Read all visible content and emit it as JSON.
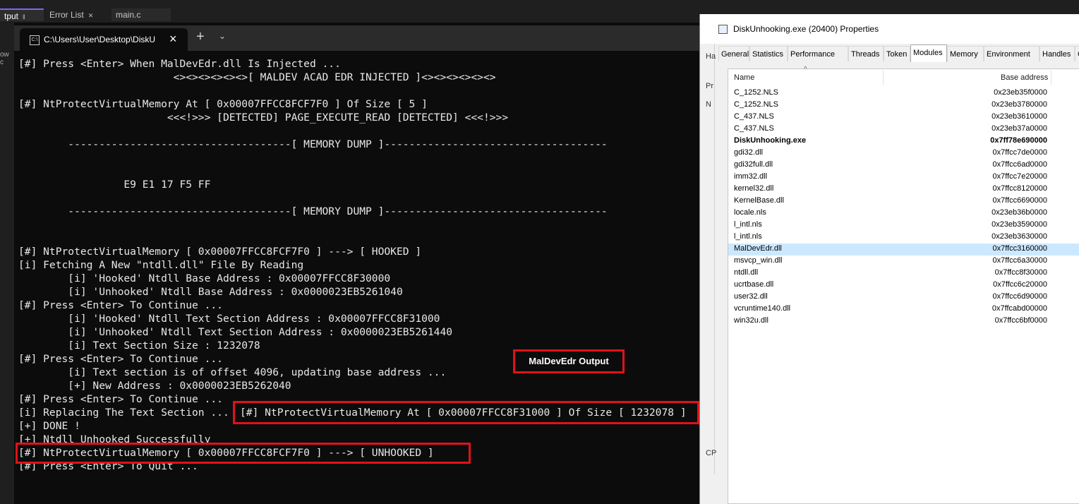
{
  "ide": {
    "tabs": [
      {
        "label": "tput",
        "active": true,
        "pin": "‖",
        "close": ""
      },
      {
        "label": "Error List",
        "active": false,
        "pin": "",
        "close": "✕"
      },
      {
        "label": "main.c",
        "active": false,
        "pin": "",
        "close": ""
      }
    ],
    "left_hint": "ow c"
  },
  "terminal": {
    "tab_title": "C:\\Users\\User\\Desktop\\DiskU",
    "tab_icon": "C:\\",
    "close_glyph": "×",
    "add_glyph": "+",
    "dropdown_glyph": "⌄",
    "lines": [
      "[#] Press <Enter> When MalDevEdr.dll Is Injected ...",
      "                         <><><><><><>[ MALDEV ACAD EDR INJECTED ]<><><><><><>",
      "",
      "[#] NtProtectVirtualMemory At [ 0x00007FFCC8FCF7F0 ] Of Size [ 5 ]",
      "                        <<<!>>> [DETECTED] PAGE_EXECUTE_READ [DETECTED] <<<!>>>",
      "",
      "        ------------------------------------[ MEMORY DUMP ]------------------------------------",
      "",
      "",
      "                 E9 E1 17 F5 FF",
      "",
      "        ------------------------------------[ MEMORY DUMP ]------------------------------------",
      "",
      "",
      "[#] NtProtectVirtualMemory [ 0x00007FFCC8FCF7F0 ] ---> [ HOOKED ]",
      "[i] Fetching A New \"ntdll.dll\" File By Reading",
      "        [i] 'Hooked' Ntdll Base Address : 0x00007FFCC8F30000",
      "        [i] 'Unhooked' Ntdll Base Address : 0x0000023EB5261040",
      "[#] Press <Enter> To Continue ...",
      "        [i] 'Hooked' Ntdll Text Section Address : 0x00007FFCC8F31000",
      "        [i] 'Unhooked' Ntdll Text Section Address : 0x0000023EB5261440",
      "        [i] Text Section Size : 1232078",
      "[#] Press <Enter> To Continue ...",
      "        [i] Text section is of offset 4096, updating base address ...",
      "        [+] New Address : 0x0000023EB5262040",
      "[#] Press <Enter> To Continue ...",
      "[i] Replacing The Text Section ...",
      "[+] DONE !",
      "[+] Ntdll Unhooked Successfully",
      "[#] NtProtectVirtualMemory [ 0x00007FFCC8FCF7F0 ] ---> [ UNHOOKED ]",
      "[#] Press <Enter> To Quit ..."
    ],
    "overlay_line": "[#] NtProtectVirtualMemory At [ 0x00007FFCC8F31000 ] Of Size [ 1232078 ]",
    "callout_label": "MalDevEdr Output"
  },
  "properties": {
    "title": "DiskUnhooking.exe (20400) Properties",
    "behind_hints": [
      "Ha",
      "Pr",
      "N",
      "CP"
    ],
    "tabs": [
      "General",
      "Statistics",
      "Performance",
      "Threads",
      "Token",
      "Modules",
      "Memory",
      "Environment",
      "Handles",
      "GP"
    ],
    "active_tab": "Modules",
    "columns": {
      "name": "Name",
      "base": "Base address"
    },
    "sort_arrow": "^",
    "modules": [
      {
        "name": "C_1252.NLS",
        "base": "0x23eb35f0000",
        "bold": false,
        "selected": false
      },
      {
        "name": "C_1252.NLS",
        "base": "0x23eb3780000",
        "bold": false,
        "selected": false
      },
      {
        "name": "C_437.NLS",
        "base": "0x23eb3610000",
        "bold": false,
        "selected": false
      },
      {
        "name": "C_437.NLS",
        "base": "0x23eb37a0000",
        "bold": false,
        "selected": false
      },
      {
        "name": "DiskUnhooking.exe",
        "base": "0x7ff78e690000",
        "bold": true,
        "selected": false
      },
      {
        "name": "gdi32.dll",
        "base": "0x7ffcc7de0000",
        "bold": false,
        "selected": false
      },
      {
        "name": "gdi32full.dll",
        "base": "0x7ffcc6ad0000",
        "bold": false,
        "selected": false
      },
      {
        "name": "imm32.dll",
        "base": "0x7ffcc7e20000",
        "bold": false,
        "selected": false
      },
      {
        "name": "kernel32.dll",
        "base": "0x7ffcc8120000",
        "bold": false,
        "selected": false
      },
      {
        "name": "KernelBase.dll",
        "base": "0x7ffcc6690000",
        "bold": false,
        "selected": false
      },
      {
        "name": "locale.nls",
        "base": "0x23eb36b0000",
        "bold": false,
        "selected": false
      },
      {
        "name": "l_intl.nls",
        "base": "0x23eb3590000",
        "bold": false,
        "selected": false
      },
      {
        "name": "l_intl.nls",
        "base": "0x23eb3630000",
        "bold": false,
        "selected": false
      },
      {
        "name": "MalDevEdr.dll",
        "base": "0x7ffcc3160000",
        "bold": false,
        "selected": true
      },
      {
        "name": "msvcp_win.dll",
        "base": "0x7ffcc6a30000",
        "bold": false,
        "selected": false
      },
      {
        "name": "ntdll.dll",
        "base": "0x7ffcc8f30000",
        "bold": false,
        "selected": false
      },
      {
        "name": "ucrtbase.dll",
        "base": "0x7ffcc6c20000",
        "bold": false,
        "selected": false
      },
      {
        "name": "user32.dll",
        "base": "0x7ffcc6d90000",
        "bold": false,
        "selected": false
      },
      {
        "name": "vcruntime140.dll",
        "base": "0x7ffcabd00000",
        "bold": false,
        "selected": false
      },
      {
        "name": "win32u.dll",
        "base": "0x7ffcc6bf0000",
        "bold": false,
        "selected": false
      }
    ]
  },
  "colors": {
    "highlight_red": "#e0121a",
    "terminal_bg": "#0c0c0c",
    "selection": "#cce8ff"
  }
}
